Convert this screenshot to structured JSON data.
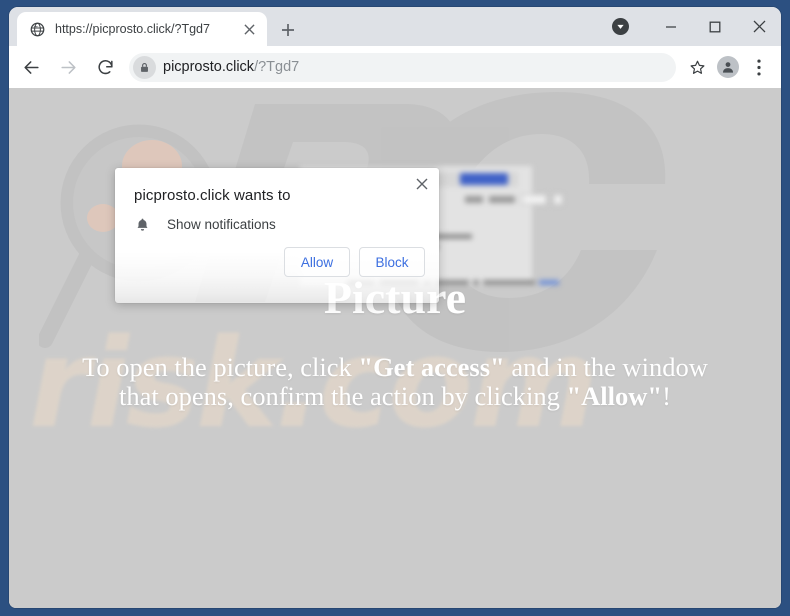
{
  "browser": {
    "tab": {
      "title": "https://picprosto.click/?Tgd7",
      "favicon": "globe-icon",
      "close": "close-tab-icon"
    },
    "new_tab_label": "+",
    "window_controls": {
      "minimize": "minimize-icon",
      "maximize": "maximize-icon",
      "close": "close-window-icon",
      "download": "download-indicator-icon"
    },
    "toolbar": {
      "back": "back-arrow-icon",
      "forward": "forward-arrow-icon",
      "reload": "reload-icon",
      "lock": "lock-icon",
      "url_host": "picprosto.click",
      "url_path": "/?Tgd7",
      "bookmark": "star-icon",
      "profile": "profile-avatar-icon",
      "menu": "three-dot-menu-icon"
    }
  },
  "permission_dialog": {
    "title": "picprosto.click wants to",
    "permission_icon": "bell-icon",
    "permission_label": "Show notifications",
    "allow_label": "Allow",
    "block_label": "Block",
    "close_label": "×",
    "accent_color": "#3c6fe0"
  },
  "page": {
    "heading": "Picture",
    "instruction_parts": {
      "a": "To open the picture, click ",
      "b": "\"Get access\"",
      "c": " and in the window that opens, confirm the action by clicking ",
      "d": "\"Allow\"",
      "e": "!"
    },
    "instruction_full": "To open the picture, click \"Get access\" and in the window that opens, confirm the action by clicking \"Allow\"!",
    "background_color": "#cbcbcb",
    "text_color": "#ffffff",
    "watermark_text": "risk.com",
    "watermark_color": "#e8d9c8"
  },
  "frame": {
    "color": "#2c5081"
  }
}
